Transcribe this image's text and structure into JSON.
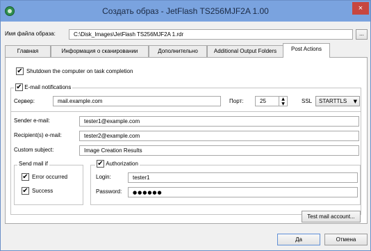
{
  "window": {
    "title": "Создать образ - JetFlash TS256MJF2A 1.00",
    "close_glyph": "×"
  },
  "image_file": {
    "label": "Имя файла образа:",
    "value": "C:\\Disk_Images\\JetFlash TS256MJF2A 1.rdr",
    "browse_label": "..."
  },
  "tabs": [
    {
      "label": "Главная"
    },
    {
      "label": "Информация о сканировании"
    },
    {
      "label": "Дополнительно"
    },
    {
      "label": "Additional Output Folders"
    },
    {
      "label": "Post Actions"
    }
  ],
  "post_actions": {
    "shutdown": {
      "label": "Shutdown the computer on task completion",
      "checked": true
    },
    "email_notifications": {
      "label": "E-mail notifications",
      "checked": true
    },
    "server": {
      "label": "Сервер:",
      "value": "mail.example.com"
    },
    "port": {
      "label": "Порт:",
      "value": "25"
    },
    "ssl": {
      "label": "SSL",
      "value": "STARTTLS"
    },
    "sender": {
      "label": "Sender e-mail:",
      "value": "tester1@example.com"
    },
    "recipients": {
      "label": "Recipient(s) e-mail:",
      "value": "tester2@example.com"
    },
    "subject": {
      "label": "Custom subject:",
      "value": "Image Creation Results"
    },
    "send_mail_if": {
      "label": "Send mail if",
      "error": {
        "label": "Error occurred",
        "checked": true
      },
      "success": {
        "label": "Success",
        "checked": true
      }
    },
    "authorization": {
      "label": "Authorization",
      "checked": true,
      "login": {
        "label": "Login:",
        "value": "tester1"
      },
      "password": {
        "label": "Password:",
        "value": "●●●●●●"
      }
    },
    "test_button": "Test mail account..."
  },
  "footer": {
    "ok_label": "Да",
    "cancel_label": "Отмена"
  },
  "icons": {
    "check": "✔",
    "spin_up": "▲",
    "spin_down": "▼",
    "dropdown": "▼"
  },
  "colors": {
    "titlebar": "#7aa3df",
    "close": "#c7463f"
  }
}
